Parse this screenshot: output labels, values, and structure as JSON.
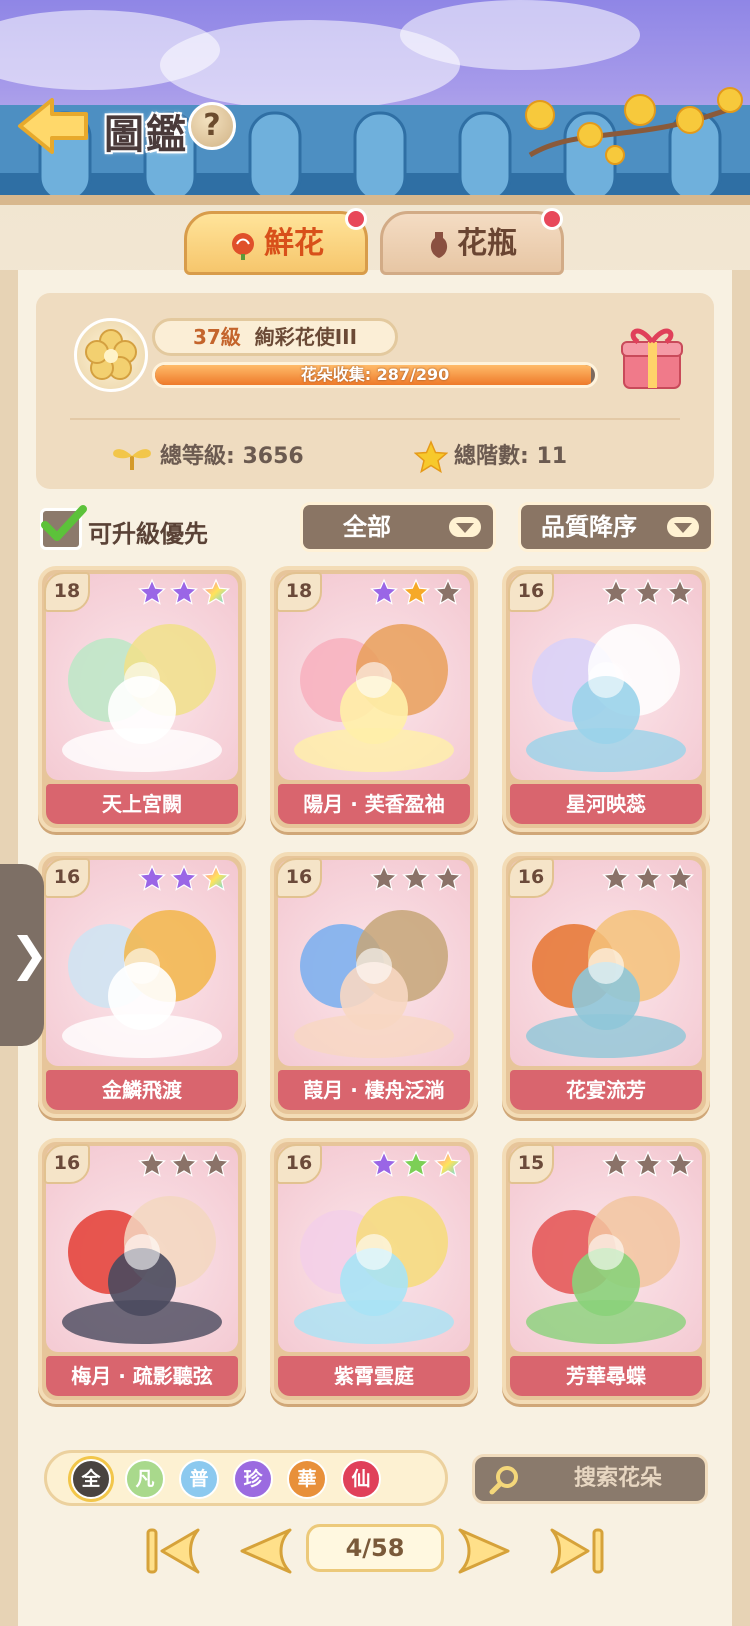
{
  "header": {
    "title": "圖鑑",
    "help_symbol": "?"
  },
  "tabs": [
    {
      "label": "鮮花",
      "active": true,
      "badge": true
    },
    {
      "label": "花瓶",
      "active": false,
      "badge": true
    }
  ],
  "summary": {
    "level_number": "37級",
    "level_title": "絢彩花使III",
    "collection_text": "花朵收集: 287/290",
    "collection_fraction": 0.99,
    "total_level_text": "總等級: 3656",
    "total_stage_text": "總階數: 11"
  },
  "filters": {
    "upgrade_priority_label": "可升級優先",
    "upgrade_priority_checked": true,
    "category_value": "全部",
    "sort_value": "品質降序"
  },
  "cards": [
    {
      "level": "18",
      "name": "天上宮闕",
      "stars": [
        "purple",
        "purple",
        "rainbow"
      ]
    },
    {
      "level": "18",
      "name": "陽月 · 芙香盈袖",
      "stars": [
        "purple",
        "gold",
        "grey"
      ]
    },
    {
      "level": "16",
      "name": "星河映蕊",
      "stars": [
        "grey",
        "grey",
        "grey"
      ]
    },
    {
      "level": "16",
      "name": "金鱗飛渡",
      "stars": [
        "purple",
        "purple",
        "rainbow"
      ]
    },
    {
      "level": "16",
      "name": "葭月 · 棲舟泛淌",
      "stars": [
        "grey",
        "grey",
        "grey"
      ]
    },
    {
      "level": "16",
      "name": "花宴流芳",
      "stars": [
        "grey",
        "grey",
        "grey"
      ]
    },
    {
      "level": "16",
      "name": "梅月 · 疏影聽弦",
      "stars": [
        "grey",
        "grey",
        "grey"
      ]
    },
    {
      "level": "16",
      "name": "紫霄雲庭",
      "stars": [
        "purple",
        "green",
        "rainbow"
      ]
    },
    {
      "level": "15",
      "name": "芳華尋蝶",
      "stars": [
        "grey",
        "grey",
        "grey"
      ]
    }
  ],
  "quality_filters": [
    {
      "label": "全",
      "color": "#4a4440"
    },
    {
      "label": "凡",
      "color": "#a9d98c"
    },
    {
      "label": "普",
      "color": "#8cc9ef"
    },
    {
      "label": "珍",
      "color": "#9b6be0"
    },
    {
      "label": "華",
      "color": "#e8903a"
    },
    {
      "label": "仙",
      "color": "#e0405a"
    }
  ],
  "search": {
    "placeholder": "搜索花朵"
  },
  "pager": {
    "page_text": "4/58"
  },
  "colors": {
    "accent_red": "#d9656e",
    "tab_active_text": "#d8501a",
    "panel": "#efdcc0"
  },
  "icons": {
    "back": "back-arrow-icon",
    "help": "question-icon",
    "gift": "gift-icon",
    "search": "search-icon",
    "handle": "chevron-right-icon"
  }
}
